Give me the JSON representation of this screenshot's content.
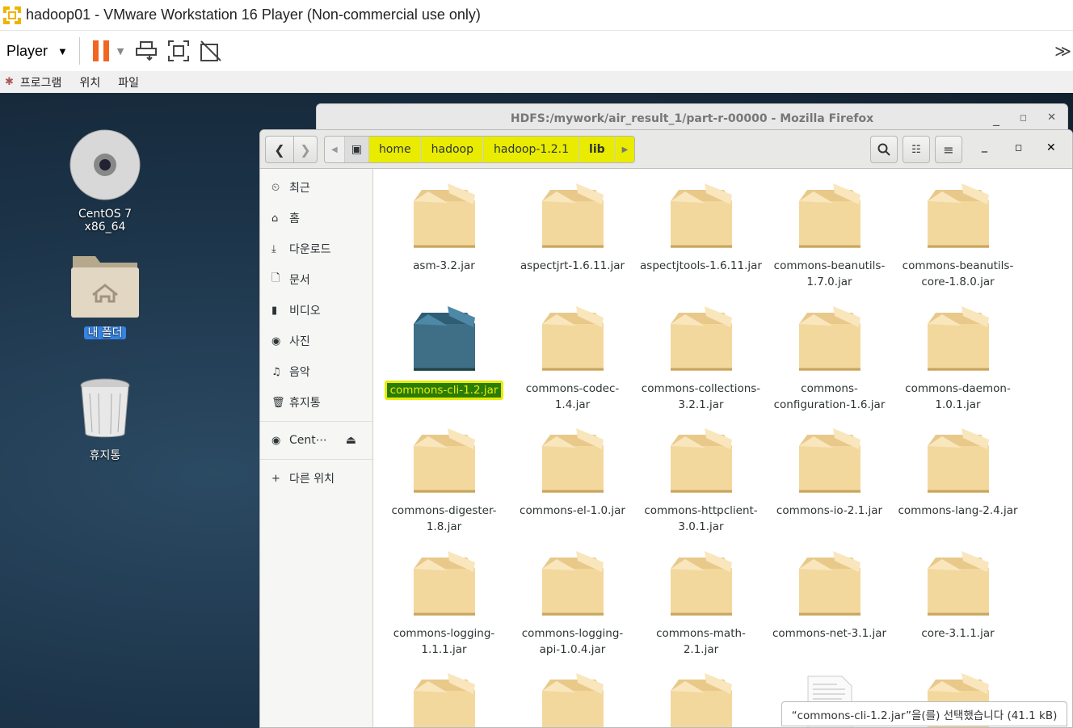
{
  "window": {
    "title": "hadoop01 - VMware Workstation 16 Player (Non-commercial use only)"
  },
  "toolbar": {
    "player_label": "Player",
    "more": "≫"
  },
  "menubar": {
    "items": [
      "프로그램",
      "위치",
      "파일"
    ]
  },
  "desktop": {
    "icons": [
      {
        "label": "CentOS 7 x86_64"
      },
      {
        "label": "내 폴더"
      },
      {
        "label": "휴지통"
      }
    ]
  },
  "firefox": {
    "title": "HDFS:/mywork/air_result_1/part-r-00000 - Mozilla Firefox"
  },
  "files": {
    "breadcrumbs": [
      "home",
      "hadoop",
      "hadoop-1.2.1",
      "lib"
    ],
    "sidebar": [
      {
        "icon": "⏲",
        "label": "최근"
      },
      {
        "icon": "⌂",
        "label": "홈"
      },
      {
        "icon": "⤓",
        "label": "다운로드"
      },
      {
        "icon": "🗋",
        "label": "문서"
      },
      {
        "icon": "▮",
        "label": "비디오"
      },
      {
        "icon": "◉",
        "label": "사진"
      },
      {
        "icon": "♫",
        "label": "음악"
      },
      {
        "icon": "🗑",
        "label": "휴지통"
      }
    ],
    "device": {
      "label": "Cent⋯",
      "eject": "⏏"
    },
    "other": {
      "label": "다른 위치",
      "icon": "+"
    },
    "items": [
      "asm-3.2.jar",
      "aspectjrt-1.6.11.jar",
      "aspectjtools-1.6.11.jar",
      "commons-beanutils-1.7.0.jar",
      "commons-beanutils-core-1.8.0.jar",
      "commons-cli-1.2.jar",
      "commons-codec-1.4.jar",
      "commons-collections-3.2.1.jar",
      "commons-configuration-1.6.jar",
      "commons-daemon-1.0.1.jar",
      "commons-digester-1.8.jar",
      "commons-el-1.0.jar",
      "commons-httpclient-3.0.1.jar",
      "commons-io-2.1.jar",
      "commons-lang-2.4.jar",
      "commons-logging-1.1.1.jar",
      "commons-logging-api-1.0.4.jar",
      "commons-math-2.1.jar",
      "commons-net-3.1.jar",
      "core-3.1.1.jar",
      "",
      "",
      "",
      "",
      ""
    ],
    "selected_index": 5,
    "status": "“commons-cli-1.2.jar”을(를) 선택했습니다 (41.1 kB)"
  },
  "colors": {
    "highlight": "#e9ec00",
    "selection": "#2a7c09",
    "pause": "#f26522"
  }
}
